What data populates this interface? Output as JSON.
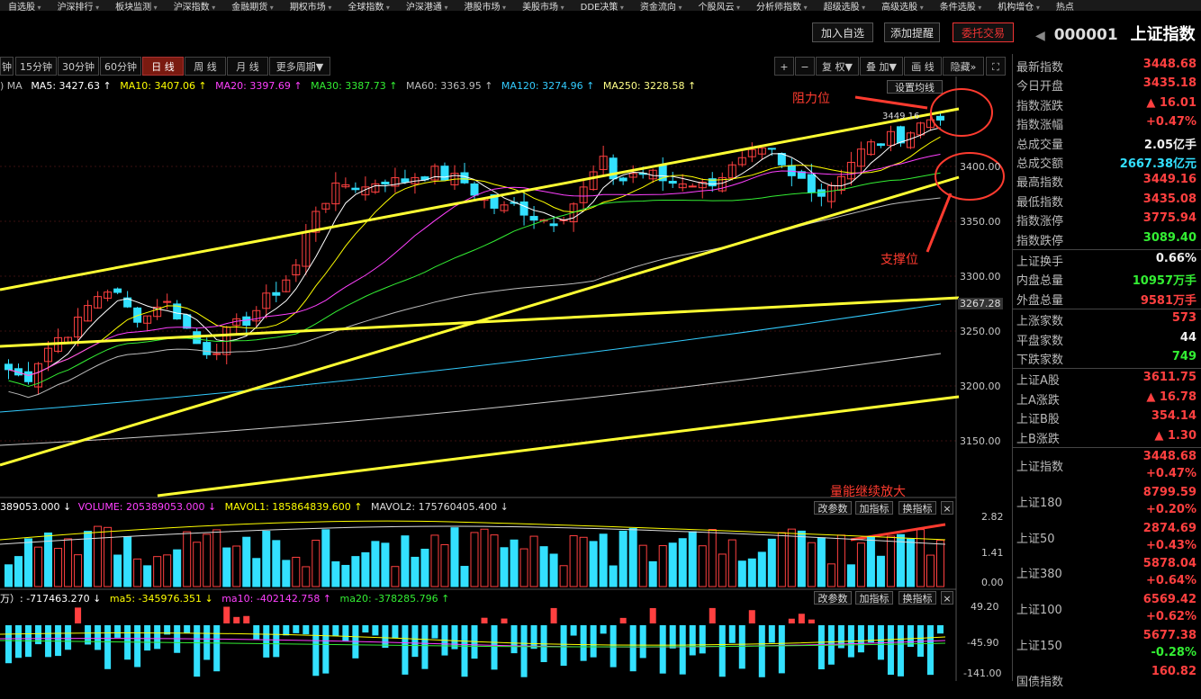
{
  "menu": [
    "自选股",
    "沪深排行",
    "板块监测",
    "沪深指数",
    "金融期货",
    "期权市场",
    "全球指数",
    "沪深港通",
    "港股市场",
    "美股市场",
    "DDE决策",
    "资金流向",
    "个股风云",
    "分析师指数",
    "超级选股",
    "高级选股",
    "条件选股",
    "机构增仓",
    "热点"
  ],
  "top_buttons": {
    "add_watch": "加入自选",
    "add_alert": "添加提醒",
    "trade": "委托交易"
  },
  "stock": {
    "code": "000001",
    "name": "上证指数"
  },
  "periods": [
    "钟",
    "15分钟",
    "30分钟",
    "60分钟",
    "日 线",
    "周 线",
    "月 线",
    "更多周期"
  ],
  "tools": [
    "+",
    "−",
    "复 权",
    "叠 加",
    "画 线",
    "隐藏"
  ],
  "ma_line": {
    "prefix": ") MA",
    "ma5": "MA5: 3427.63 ↑",
    "ma10": "MA10: 3407.06 ↑",
    "ma20": "MA20: 3397.69 ↑",
    "ma30": "MA30: 3387.73 ↑",
    "ma60": "MA60: 3363.95 ↑",
    "ma120": "MA120: 3274.96 ↑",
    "ma250": "MA250: 3228.58 ↑"
  },
  "settings_btn": "设置均线",
  "price_axis": [
    "3400.00",
    "3350.00",
    "3300.00",
    "3250.00",
    "3200.00",
    "3150.00"
  ],
  "current_price_tag": "3267.28",
  "high_label": "3449.16",
  "annotations": {
    "resistance": "阻力位",
    "support": "支撑位",
    "volume": "量能继续放大"
  },
  "volume_line": {
    "v1": "389053.000 ↓",
    "v2": "VOLUME: 205389053.000 ↓",
    "v3": "MAVOL1: 185864839.600 ↑",
    "v4": "MAVOL2: 175760405.400 ↓"
  },
  "volume_axis": [
    "2.82",
    "1.41",
    "0.00"
  ],
  "indicator_line": {
    "v1": "万）: -717463.270 ↓",
    "v2": "ma5: -345976.351 ↓",
    "v3": "ma10: -402142.758 ↑",
    "v4": "ma20: -378285.796 ↑"
  },
  "indicator_axis": [
    "49.20",
    "-45.90",
    "-141.00"
  ],
  "chart_buttons": {
    "change": "改参数",
    "add": "加指标",
    "switch": "换指标"
  },
  "quote": [
    {
      "k": "最新指数",
      "v": "3448.68",
      "c": "red"
    },
    {
      "k": "今日开盘",
      "v": "3435.18",
      "c": "red"
    },
    {
      "k": "指数涨跌",
      "v": "▲ 16.01",
      "c": "red"
    },
    {
      "k": "指数涨幅",
      "v": "+0.47%",
      "c": "red"
    },
    {
      "k": "总成交量",
      "v": "2.05亿手",
      "c": "white"
    },
    {
      "k": "总成交额",
      "v": "2667.38亿元",
      "c": "cyan"
    },
    {
      "k": "最高指数",
      "v": "3449.16",
      "c": "red"
    },
    {
      "k": "最低指数",
      "v": "3435.08",
      "c": "red"
    },
    {
      "k": "指数涨停",
      "v": "3775.94",
      "c": "red"
    },
    {
      "k": "指数跌停",
      "v": "3089.40",
      "c": "green"
    }
  ],
  "stats": [
    {
      "k": "上证换手",
      "v": "0.66%",
      "c": "white"
    },
    {
      "k": "内盘总量",
      "v": "10957万手",
      "c": "green"
    },
    {
      "k": "外盘总量",
      "v": "9581万手",
      "c": "red"
    }
  ],
  "breadth": [
    {
      "k": "上涨家数",
      "v": "573",
      "c": "red"
    },
    {
      "k": "平盘家数",
      "v": "44",
      "c": "white"
    },
    {
      "k": "下跌家数",
      "v": "749",
      "c": "green"
    }
  ],
  "ab": [
    {
      "k": "上证A股",
      "v": "3611.75",
      "c": "red"
    },
    {
      "k": "上A涨跌",
      "v": "▲ 16.78",
      "c": "red"
    },
    {
      "k": "上证B股",
      "v": "354.14",
      "c": "red"
    },
    {
      "k": "上B涨跌",
      "v": "▲ 1.30",
      "c": "red"
    }
  ],
  "indices": [
    {
      "k": "上证指数",
      "v": "3448.68",
      "p": "+0.47%",
      "pc": "red"
    },
    {
      "k": "上证180",
      "v": "8799.59",
      "p": "+0.20%",
      "pc": "red"
    },
    {
      "k": "上证50",
      "v": "2874.69",
      "p": "+0.43%",
      "pc": "red"
    },
    {
      "k": "上证380",
      "v": "5878.04",
      "p": "+0.64%",
      "pc": "red"
    },
    {
      "k": "上证100",
      "v": "6569.42",
      "p": "+0.62%",
      "pc": "red"
    },
    {
      "k": "上证150",
      "v": "5677.38",
      "p": "-0.28%",
      "pc": "green"
    },
    {
      "k": "国债指数",
      "v": "160.82",
      "p": "",
      "pc": "red"
    }
  ],
  "colors": {
    "up": "#ff4040",
    "down": "#33e0ff",
    "channel": "#ffff33",
    "ma5": "#ffffff",
    "ma10": "#ffff00",
    "ma20": "#ff40ff",
    "ma30": "#33ee33",
    "ma60": "#bbbbbb",
    "ma120": "#33ccff"
  }
}
